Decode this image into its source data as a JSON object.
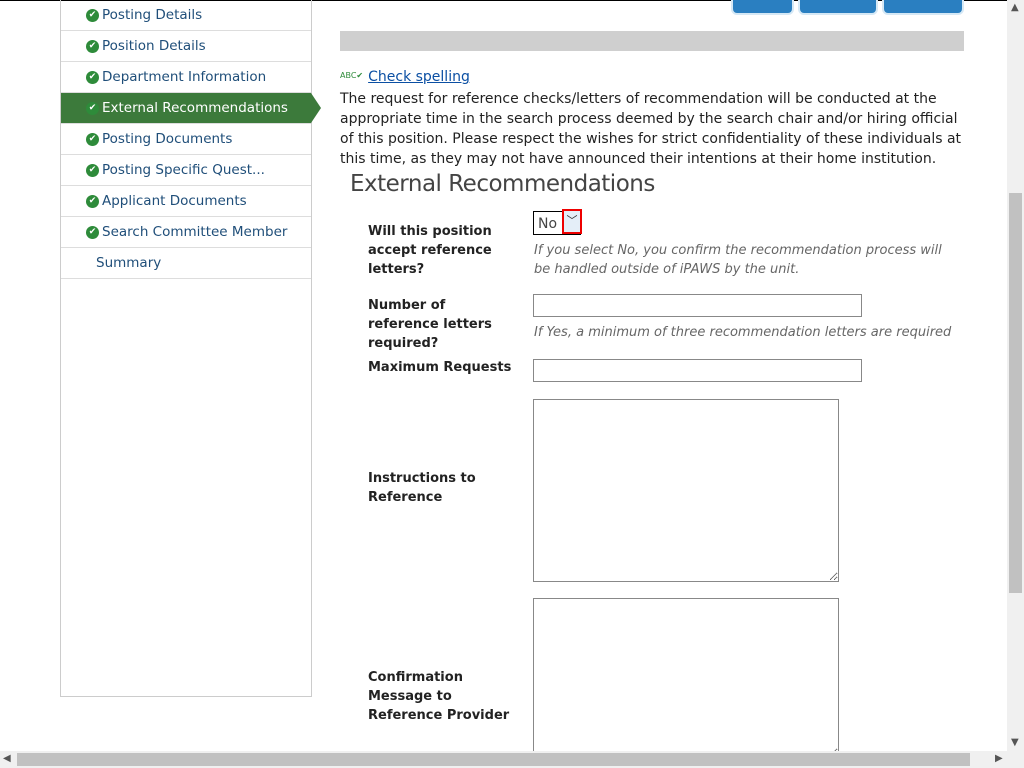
{
  "sidebar": {
    "items": [
      {
        "label": "Posting Details",
        "done": true
      },
      {
        "label": "Position Details",
        "done": true
      },
      {
        "label": "Department Information",
        "done": true
      },
      {
        "label": "External Recommendations",
        "done": true,
        "active": true
      },
      {
        "label": "Posting Documents",
        "done": true
      },
      {
        "label": "Posting Specific Quest...",
        "done": true
      },
      {
        "label": "Applicant Documents",
        "done": true
      },
      {
        "label": "Search Committee Member",
        "done": true
      },
      {
        "label": "Summary",
        "done": false
      }
    ]
  },
  "spell": "Check spelling",
  "intro": "The request for reference checks/letters of recommendation will be conducted at the appropriate time in the search process deemed by the search chair and/or hiring official of this position. Please respect the wishes for strict confidentiality of these individuals at this time, as they may not have announced their intentions at their home institution.",
  "section_title": "External Recommendations",
  "fields": {
    "accept": {
      "label": "Will this position accept reference letters?",
      "value": "No",
      "hint": "If you select No, you confirm the recommendation process will be handled outside of iPAWS by the unit."
    },
    "number": {
      "label": "Number of reference letters required?",
      "value": "",
      "hint": "If Yes, a minimum of three recommendation letters are required"
    },
    "max": {
      "label": "Maximum Requests",
      "value": ""
    },
    "instructions": {
      "label": "Instructions to Reference",
      "value": ""
    },
    "confirmation": {
      "label": "Confirmation Message to Reference Provider",
      "value": ""
    }
  },
  "colors": {
    "active": "#3c7a3b",
    "button": "#2a7fc1",
    "highlight": "#ff0000"
  }
}
